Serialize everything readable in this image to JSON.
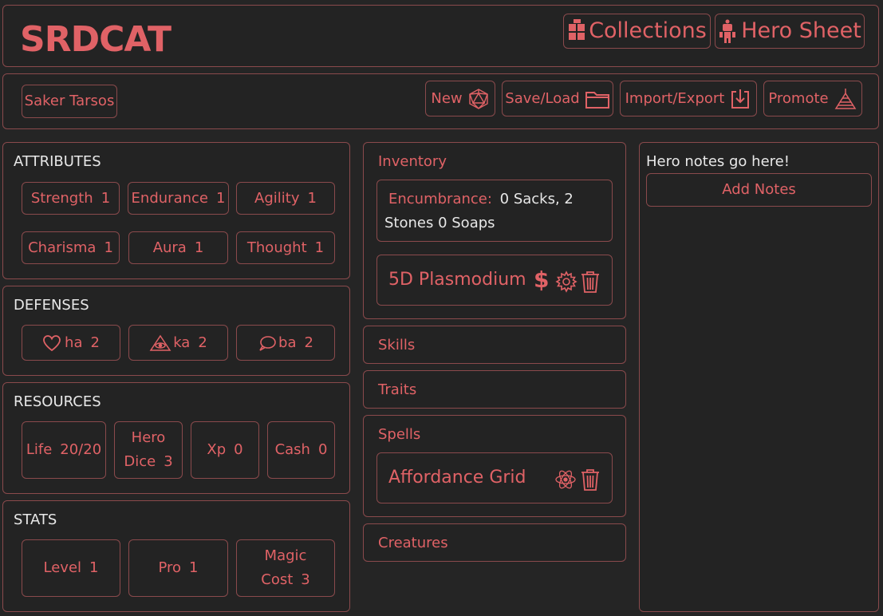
{
  "header": {
    "logo_text": "SRDCAT",
    "collections_label": "Collections",
    "hero_sheet_label": "Hero Sheet"
  },
  "toolbar": {
    "hero_name": "Saker Tarsos",
    "new_label": "New",
    "save_load_label": "Save/Load",
    "import_export_label": "Import/Export",
    "promote_label": "Promote"
  },
  "attributes": {
    "title": "ATTRIBUTES",
    "items": [
      {
        "label": "Strength",
        "value": "1"
      },
      {
        "label": "Endurance",
        "value": "1"
      },
      {
        "label": "Agility",
        "value": "1"
      },
      {
        "label": "Charisma",
        "value": "1"
      },
      {
        "label": "Aura",
        "value": "1"
      },
      {
        "label": "Thought",
        "value": "1"
      }
    ]
  },
  "defenses": {
    "title": "DEFENSES",
    "items": [
      {
        "label": "ha",
        "value": "2",
        "icon": "heart-icon"
      },
      {
        "label": "ka",
        "value": "2",
        "icon": "eye-pyramid-icon"
      },
      {
        "label": "ba",
        "value": "2",
        "icon": "speech-bubble-icon"
      }
    ]
  },
  "resources": {
    "title": "RESOURCES",
    "life_label": "Life",
    "life_value": "20/20",
    "hero_dice_label_1": "Hero",
    "hero_dice_label_2": "Dice",
    "hero_dice_value": "3",
    "xp_label": "Xp",
    "xp_value": "0",
    "cash_label": "Cash",
    "cash_value": "0"
  },
  "stats": {
    "title": "STATS",
    "level_label": "Level",
    "level_value": "1",
    "pro_label": "Pro",
    "pro_value": "1",
    "magic_label_1": "Magic",
    "magic_label_2": "Cost",
    "magic_value": "3"
  },
  "inventory": {
    "title": "Inventory",
    "encumbrance_label": "Encumbrance:",
    "encumbrance_value_1": "0 Sacks, 2",
    "encumbrance_value_2": "Stones 0 Soaps",
    "item_name": "5D Plasmodium"
  },
  "sections": {
    "skills": "Skills",
    "traits": "Traits",
    "spells": "Spells",
    "spell_item": "Affordance Grid",
    "creatures": "Creatures"
  },
  "notes": {
    "text": "Hero notes go here!",
    "add_label": "Add Notes"
  },
  "colors": {
    "accent": "#e06266",
    "background": "#252525",
    "border": "#8a4a4c",
    "text": "#e8e8e8"
  }
}
